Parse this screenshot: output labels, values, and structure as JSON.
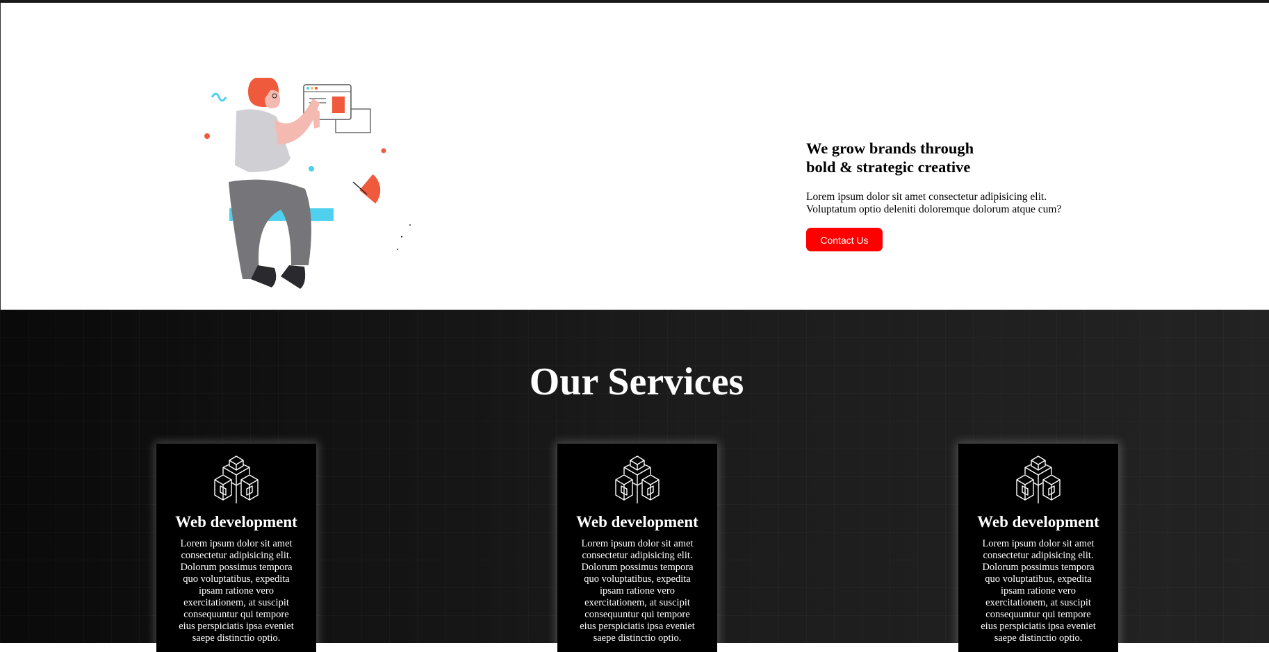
{
  "hero": {
    "title_line1": "We grow brands through",
    "title_line2": "bold & strategic creative",
    "desc_line1": "Lorem ipsum dolor sit amet consectetur adipisicing elit.",
    "desc_line2": "Voluptatum optio deleniti doloremque dolorum atque cum?",
    "cta_label": "Contact Us",
    "illustration_icon": "person-browsing-illustration"
  },
  "services": {
    "title": "Our Services",
    "cards": [
      {
        "icon": "cube-cluster-icon",
        "title": "Web development",
        "desc_lines": [
          "Lorem ipsum dolor sit amet",
          "consectetur adipisicing elit.",
          "Dolorum possimus tempora",
          "quo voluptatibus, expedita",
          "ipsam ratione vero",
          "exercitationem, at suscipit",
          "consequuntur qui tempore",
          "eius perspiciatis ipsa eveniet",
          "saepe distinctio optio."
        ]
      },
      {
        "icon": "cube-cluster-icon",
        "title": "Web development",
        "desc_lines": [
          "Lorem ipsum dolor sit amet",
          "consectetur adipisicing elit.",
          "Dolorum possimus tempora",
          "quo voluptatibus, expedita",
          "ipsam ratione vero",
          "exercitationem, at suscipit",
          "consequuntur qui tempore",
          "eius perspiciatis ipsa eveniet",
          "saepe distinctio optio."
        ]
      },
      {
        "icon": "cube-cluster-icon",
        "title": "Web development",
        "desc_lines": [
          "Lorem ipsum dolor sit amet",
          "consectetur adipisicing elit.",
          "Dolorum possimus tempora",
          "quo voluptatibus, expedita",
          "ipsam ratione vero",
          "exercitationem, at suscipit",
          "consequuntur qui tempore",
          "eius perspiciatis ipsa eveniet",
          "saepe distinctio optio."
        ]
      }
    ]
  },
  "colors": {
    "accent": "#ff0000",
    "hero_bg": "#ffffff",
    "services_bg": "#161616",
    "card_bg": "#000000",
    "illustration_hair": "#f05a3c",
    "illustration_cyan": "#4fd0ee"
  }
}
